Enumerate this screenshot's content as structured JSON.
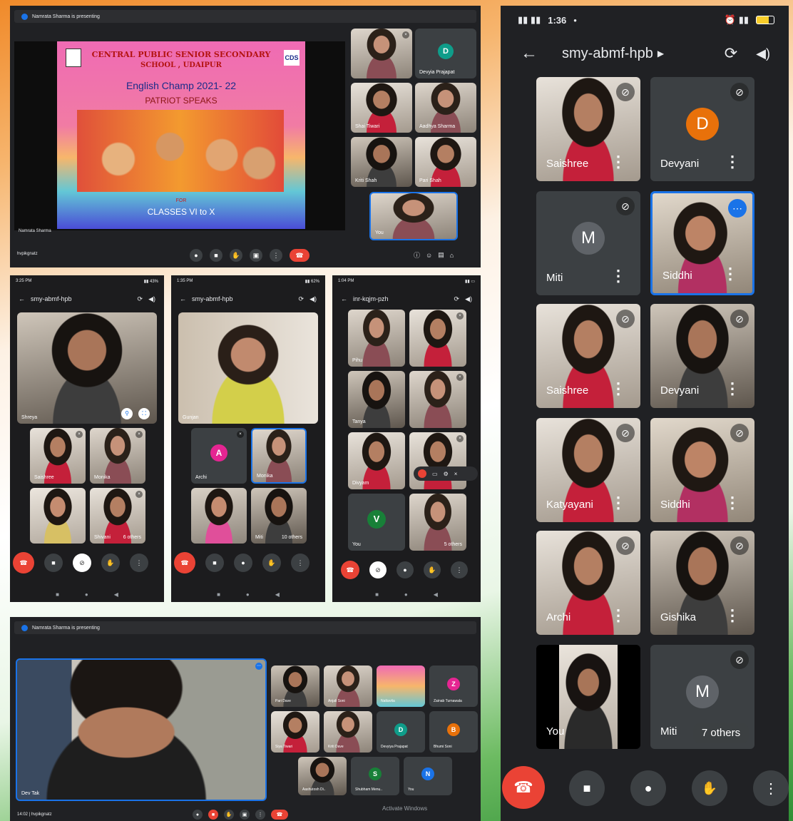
{
  "top_left": {
    "presenting": "Namrata Sharma is presenting",
    "slide": {
      "school": "CENTRAL PUBLIC SENIOR SECONDARY",
      "city": "SCHOOL , UDAIPUR",
      "event": "English Champ 2021- 22",
      "subtitle": "PATRIOT SPEAKS",
      "for": "FOR",
      "classes": "CLASSES VI to X",
      "logo_right": "CDS"
    },
    "presenter_name": "Namrata Sharma",
    "meeting_code": "hvpikgnatz",
    "tiles": [
      {
        "name": ""
      },
      {
        "name": "Devyia Prajapat",
        "initial": "D"
      },
      {
        "name": "Shai Tiwari"
      },
      {
        "name": "Aadhya Sharma"
      },
      {
        "name": "Kriti Shah"
      },
      {
        "name": "Pari Shah"
      },
      {
        "name": "You"
      }
    ]
  },
  "phone1": {
    "time": "3:25 PM",
    "title": "smy-abmf-hpb",
    "main_name": "Shreya",
    "tiles": [
      {
        "name": "Saishree"
      },
      {
        "name": "Monika"
      },
      {
        "name": ""
      },
      {
        "name": "Shivani",
        "extra": "6 others"
      }
    ]
  },
  "phone2": {
    "time": "1:35 PM",
    "title": "smy-abmf-hpb",
    "main_name": "Gunjan",
    "tiles": [
      {
        "name": "Archi",
        "initial": "A"
      },
      {
        "name": "Monika"
      },
      {
        "name": ""
      },
      {
        "name": "Miti",
        "extra": "10 others"
      }
    ]
  },
  "phone3": {
    "time": "1:04 PM",
    "title": "inr-kqjm-pzh",
    "tiles": [
      {
        "name": "Pihu"
      },
      {
        "name": ""
      },
      {
        "name": "Tanya"
      },
      {
        "name": ""
      },
      {
        "name": "Divyam"
      },
      {
        "name": ""
      },
      {
        "name": "You",
        "initial": "V"
      },
      {
        "name": "",
        "extra": "5 others"
      }
    ]
  },
  "bottom_left": {
    "presenting": "Namrata Sharma is presenting",
    "main_name": "Dev Tak",
    "time": "14:02",
    "meeting_code": "hvpikgnatz",
    "watermark": "Activate Windows",
    "tiles": [
      {
        "name": "Pari Dave"
      },
      {
        "name": "Anjali Soni"
      },
      {
        "name": "Nattavita"
      },
      {
        "name": "Zainab Turnawala",
        "initial": "Z"
      },
      {
        "name": "Siya Tiwari"
      },
      {
        "name": "Kriti Dave"
      },
      {
        "name": "Devyiya Prajapat",
        "initial": "D"
      },
      {
        "name": "Bhumi Soni",
        "initial": "B"
      },
      {
        "name": "Aashutosh Di.."
      },
      {
        "name": "Shubham Menu..",
        "initial": "S"
      },
      {
        "name": "You",
        "initial": "N"
      }
    ]
  },
  "right_phone": {
    "time": "1:36",
    "title": "smy-abmf-hpb",
    "tiles": [
      {
        "name": "Saishree"
      },
      {
        "name": "Devyani",
        "initial": "D"
      },
      {
        "name": "Miti",
        "initial": "M"
      },
      {
        "name": "Siddhi"
      },
      {
        "name": "Saishree"
      },
      {
        "name": "Devyani"
      },
      {
        "name": "Katyayani"
      },
      {
        "name": "Siddhi"
      },
      {
        "name": "Archi"
      },
      {
        "name": "Gishika"
      },
      {
        "name": "You"
      },
      {
        "name": "Miti",
        "initial": "M",
        "extra": "7 others"
      }
    ]
  },
  "colors": {
    "meet_bg": "#202124",
    "tile_bg": "#3c4043",
    "end_call": "#ea4335",
    "accent_blue": "#1a73e8",
    "orange": "#e8710a",
    "teal": "#0f9d8a",
    "pink": "#e52592",
    "green": "#188038"
  },
  "icons": [
    "mic-off-icon",
    "end-call-icon",
    "camera-icon",
    "mic-icon",
    "hand-icon",
    "more-icon",
    "back-icon",
    "switch-camera-icon",
    "speaker-icon",
    "present-icon",
    "chat-icon",
    "people-icon"
  ]
}
